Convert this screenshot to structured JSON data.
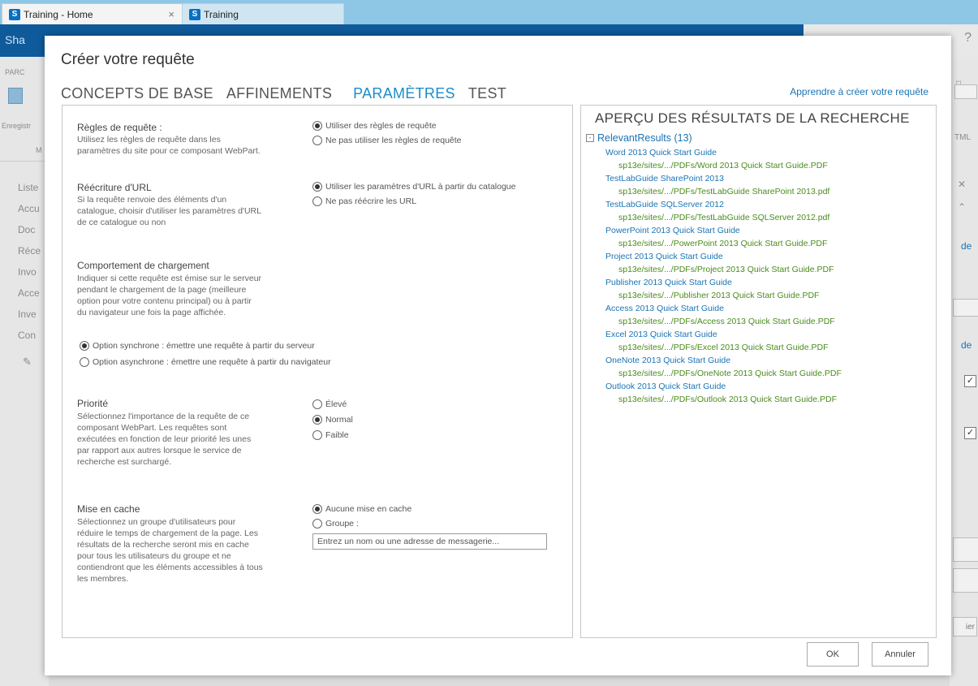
{
  "browser": {
    "tabs": [
      {
        "label": "Training - Home",
        "close": "×"
      },
      {
        "label": "Training"
      }
    ]
  },
  "background": {
    "suite_title": "Sha",
    "ribbon_tab": "PARC",
    "save_label": "Enregistr",
    "ribbon_group": "M",
    "nav_items": [
      "Liste",
      "Accu",
      "Doc",
      "Réce",
      "Invo",
      "Acce",
      "Inve",
      "Con"
    ],
    "help": "?",
    "html_label": "TML",
    "right_links": [
      "de",
      "de"
    ],
    "right_button": "ier"
  },
  "dialog": {
    "title": "Créer votre requête",
    "tabs": [
      "CONCEPTS DE BASE",
      "AFFINEMENTS",
      "PARAMÈTRES",
      "TEST"
    ],
    "learn_link": "Apprendre à créer votre requête",
    "sections": {
      "rules": {
        "title": "Règles de requête :",
        "desc": [
          "Utilisez les règles de requête dans les",
          "paramètres du site pour ce composant WebPart."
        ],
        "options": [
          "Utiliser des règles de requête",
          "Ne pas utiliser les règles de requête"
        ],
        "selected": 0
      },
      "url": {
        "title": "Réécriture d'URL",
        "desc": [
          "Si la requête renvoie des éléments d'un",
          "catalogue, choisir d'utiliser les paramètres d'URL",
          "de ce catalogue ou non"
        ],
        "options": [
          "Utiliser les paramètres d'URL à partir du catalogue",
          "Ne pas réécrire les URL"
        ],
        "selected": 0
      },
      "loading": {
        "title": "Comportement de chargement",
        "desc": [
          "Indiquer si cette requête est émise sur le serveur",
          "pendant le chargement de la page (meilleure",
          "option pour votre contenu principal) ou à partir",
          "du navigateur une fois la page affichée."
        ],
        "options": [
          "Option synchrone : émettre une requête à partir du serveur",
          "Option asynchrone : émettre une requête à partir du navigateur"
        ],
        "selected": 0
      },
      "priority": {
        "title": "Priorité",
        "desc": [
          "Sélectionnez l'importance de la requête de ce",
          "composant WebPart. Les requêtes sont",
          "exécutées en fonction de leur priorité les unes",
          "par rapport aux autres lorsque le service de",
          "recherche est surchargé."
        ],
        "options": [
          "Élevé",
          "Normal",
          "Faible"
        ],
        "selected": 1
      },
      "cache": {
        "title": "Mise en cache",
        "desc": [
          "Sélectionnez un groupe d'utilisateurs pour",
          "réduire le temps de chargement de la page. Les",
          "résultats de la recherche seront mis en cache",
          "pour tous les utilisateurs du groupe et ne",
          "contiendront que les éléments accessibles à tous",
          "les membres."
        ],
        "options": [
          "Aucune mise en cache",
          "Groupe :"
        ],
        "selected": 0,
        "input_placeholder": "Entrez un nom ou une adresse de messagerie..."
      }
    },
    "preview": {
      "title": "APERÇU DES RÉSULTATS DE LA RECHERCHE",
      "root": "RelevantResults (13)",
      "collapse_symbol": "-",
      "results": [
        {
          "title": "Word 2013 Quick Start Guide",
          "url": "sp13e/sites/.../PDFs/Word 2013 Quick Start Guide.PDF"
        },
        {
          "title": "TestLabGuide SharePoint 2013",
          "url": "sp13e/sites/.../PDFs/TestLabGuide SharePoint 2013.pdf"
        },
        {
          "title": "TestLabGuide SQLServer 2012",
          "url": "sp13e/sites/.../PDFs/TestLabGuide SQLServer 2012.pdf"
        },
        {
          "title": "PowerPoint 2013 Quick Start Guide",
          "url": "sp13e/sites/.../PowerPoint 2013 Quick Start Guide.PDF"
        },
        {
          "title": "Project 2013 Quick Start Guide",
          "url": "sp13e/sites/.../PDFs/Project 2013 Quick Start Guide.PDF"
        },
        {
          "title": "Publisher 2013 Quick Start Guide",
          "url": "sp13e/sites/.../Publisher 2013 Quick Start Guide.PDF"
        },
        {
          "title": "Access 2013 Quick Start Guide",
          "url": "sp13e/sites/.../PDFs/Access 2013 Quick Start Guide.PDF"
        },
        {
          "title": "Excel 2013 Quick Start Guide",
          "url": "sp13e/sites/.../PDFs/Excel 2013 Quick Start Guide.PDF"
        },
        {
          "title": "OneNote 2013 Quick Start Guide",
          "url": "sp13e/sites/.../PDFs/OneNote 2013 Quick Start Guide.PDF"
        },
        {
          "title": "Outlook 2013 Quick Start Guide",
          "url": "sp13e/sites/.../PDFs/Outlook 2013 Quick Start Guide.PDF"
        }
      ]
    },
    "ok_label": "OK",
    "cancel_label": "Annuler"
  },
  "colors": {
    "accent": "#1b8cc8",
    "link": "#1b74b4",
    "url_green": "#4a8c1c",
    "suite_bar": "#0f5a9a"
  }
}
